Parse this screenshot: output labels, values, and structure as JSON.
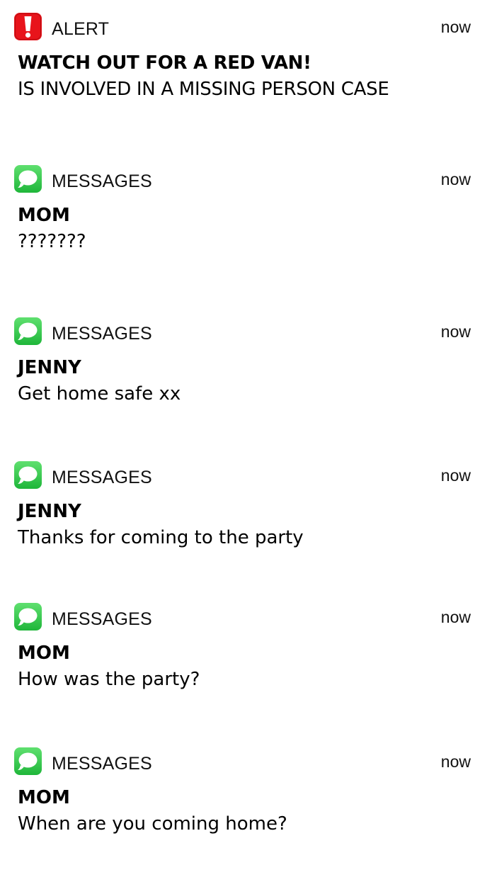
{
  "colors": {
    "alert_red": "#e8141b",
    "messages_green": "#35c759",
    "background": "#ffffff",
    "text": "#000000"
  },
  "notifications": [
    {
      "app": "ALERT",
      "icon": "alert-exclamation-icon",
      "time": "now",
      "title": "WATCH OUT FOR A RED VAN!",
      "body": "IS INVOLVED IN A MISSING PERSON CASE"
    },
    {
      "app": "MESSAGES",
      "icon": "messages-bubble-icon",
      "time": "now",
      "title": "MOM",
      "body": "???????"
    },
    {
      "app": "MESSAGES",
      "icon": "messages-bubble-icon",
      "time": "now",
      "title": "JENNY",
      "body": "Get home safe xx"
    },
    {
      "app": "MESSAGES",
      "icon": "messages-bubble-icon",
      "time": "now",
      "title": "JENNY",
      "body": "Thanks for coming to the party"
    },
    {
      "app": "MESSAGES",
      "icon": "messages-bubble-icon",
      "time": "now",
      "title": "MOM",
      "body": "How was the party?"
    },
    {
      "app": "MESSAGES",
      "icon": "messages-bubble-icon",
      "time": "now",
      "title": "MOM",
      "body": "When are you coming home?"
    }
  ]
}
